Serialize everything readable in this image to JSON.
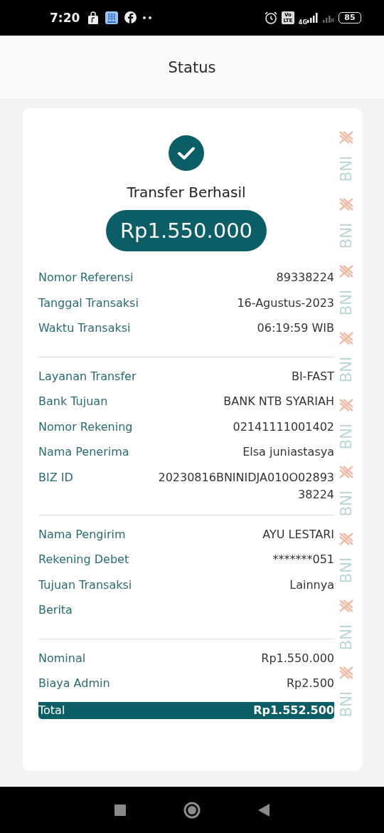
{
  "status_bar": {
    "time": "7:20",
    "network_badge": "Vo LTE",
    "network_type": "4G",
    "battery": "85"
  },
  "app_bar": {
    "title": "Status"
  },
  "receipt": {
    "status": "Transfer Berhasil",
    "amount": "Rp1.550.000",
    "sections": [
      {
        "rows": [
          {
            "label": "Nomor Referensi",
            "value": "89338224"
          },
          {
            "label": "Tanggal Transaksi",
            "value": "16-Agustus-2023"
          },
          {
            "label": "Waktu Transaksi",
            "value": "06:19:59 WIB"
          }
        ]
      },
      {
        "rows": [
          {
            "label": "Layanan Transfer",
            "value": "BI-FAST"
          },
          {
            "label": "Bank Tujuan",
            "value": "BANK NTB SYARIAH"
          },
          {
            "label": "Nomor Rekening",
            "value": "02141111001402"
          },
          {
            "label": "Nama Penerima",
            "value": "Elsa juniastasya"
          },
          {
            "label": "BIZ ID",
            "value": "20230816BNINIDJA010O0289338224"
          }
        ]
      },
      {
        "rows": [
          {
            "label": "Nama Pengirim",
            "value": "AYU LESTARI"
          },
          {
            "label": "Rekening Debet",
            "value": "*******051"
          },
          {
            "label": "Tujuan Transaksi",
            "value": "Lainnya"
          },
          {
            "label": "Berita"
          }
        ]
      },
      {
        "rows": [
          {
            "label": "Nominal",
            "value": "Rp1.550.000",
            "kind": "plain"
          },
          {
            "label": "Biaya Admin",
            "value": "Rp2.500",
            "kind": "plain"
          },
          {
            "label": "Total",
            "value": "Rp1.552.500",
            "kind": "total"
          }
        ]
      }
    ],
    "side_pattern": [
      "BNI",
      "BNI",
      "BNI",
      "BNI",
      "BNI",
      "BNI",
      "BNI",
      "BNI",
      "BNI"
    ]
  }
}
